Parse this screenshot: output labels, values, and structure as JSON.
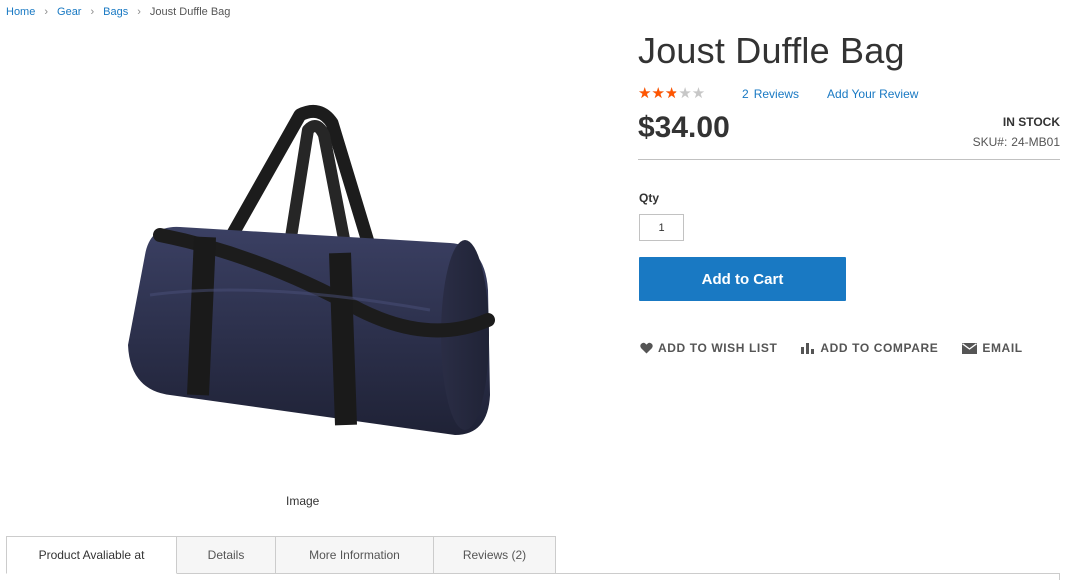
{
  "breadcrumb": {
    "items": [
      "Home",
      "Gear",
      "Bags"
    ],
    "current": "Joust Duffle Bag"
  },
  "product": {
    "title": "Joust Duffle Bag",
    "rating_fraction": 0.5,
    "reviews_count": "2",
    "reviews_label": "Reviews",
    "add_review": "Add Your Review",
    "price": "$34.00",
    "stock": "IN STOCK",
    "sku_label": "SKU#:",
    "sku": "24-MB01",
    "image_caption": "Image"
  },
  "purchase": {
    "qty_label": "Qty",
    "qty_value": "1",
    "add_to_cart": "Add to Cart"
  },
  "actions": {
    "wishlist": "ADD TO WISH LIST",
    "compare": "ADD TO COMPARE",
    "email": "EMAIL"
  },
  "tabs": [
    {
      "label": "Product Avaliable at",
      "active": true
    },
    {
      "label": "Details",
      "active": false
    },
    {
      "label": "More Information",
      "active": false
    },
    {
      "label": "Reviews (2)",
      "active": false
    }
  ],
  "colors": {
    "accent": "#1979c3",
    "star": "#ff5501",
    "bag": "#2b2f4a",
    "strap": "#1c1c1c"
  },
  "icons": {
    "stars": "star-icon",
    "wishlist": "heart-icon",
    "compare": "bar-chart-icon",
    "email": "envelope-icon"
  }
}
